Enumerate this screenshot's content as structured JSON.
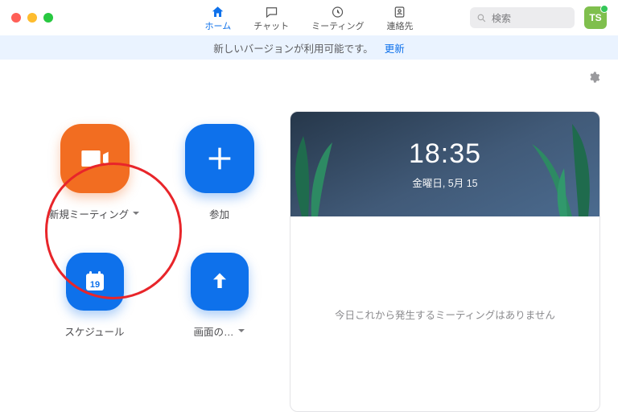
{
  "nav": {
    "tabs": [
      {
        "label": "ホーム"
      },
      {
        "label": "チャット"
      },
      {
        "label": "ミーティング"
      },
      {
        "label": "連絡先"
      }
    ],
    "active_index": 0
  },
  "search": {
    "placeholder": "検索"
  },
  "avatar": {
    "initials": "TS"
  },
  "banner": {
    "message": "新しいバージョンが利用可能です。",
    "action": "更新"
  },
  "tiles": {
    "new_meeting": {
      "label": "新規ミーティング"
    },
    "join": {
      "label": "参加"
    },
    "schedule": {
      "label": "スケジュール",
      "calendar_day": "19"
    },
    "share": {
      "label": "画面の…"
    }
  },
  "clock": {
    "time": "18:35",
    "date": "金曜日, 5月 15"
  },
  "upcoming_empty": "今日これから発生するミーティングはありません",
  "colors": {
    "accent_blue": "#0e71eb",
    "accent_orange": "#f26d21",
    "highlight_red": "#e8252a"
  }
}
